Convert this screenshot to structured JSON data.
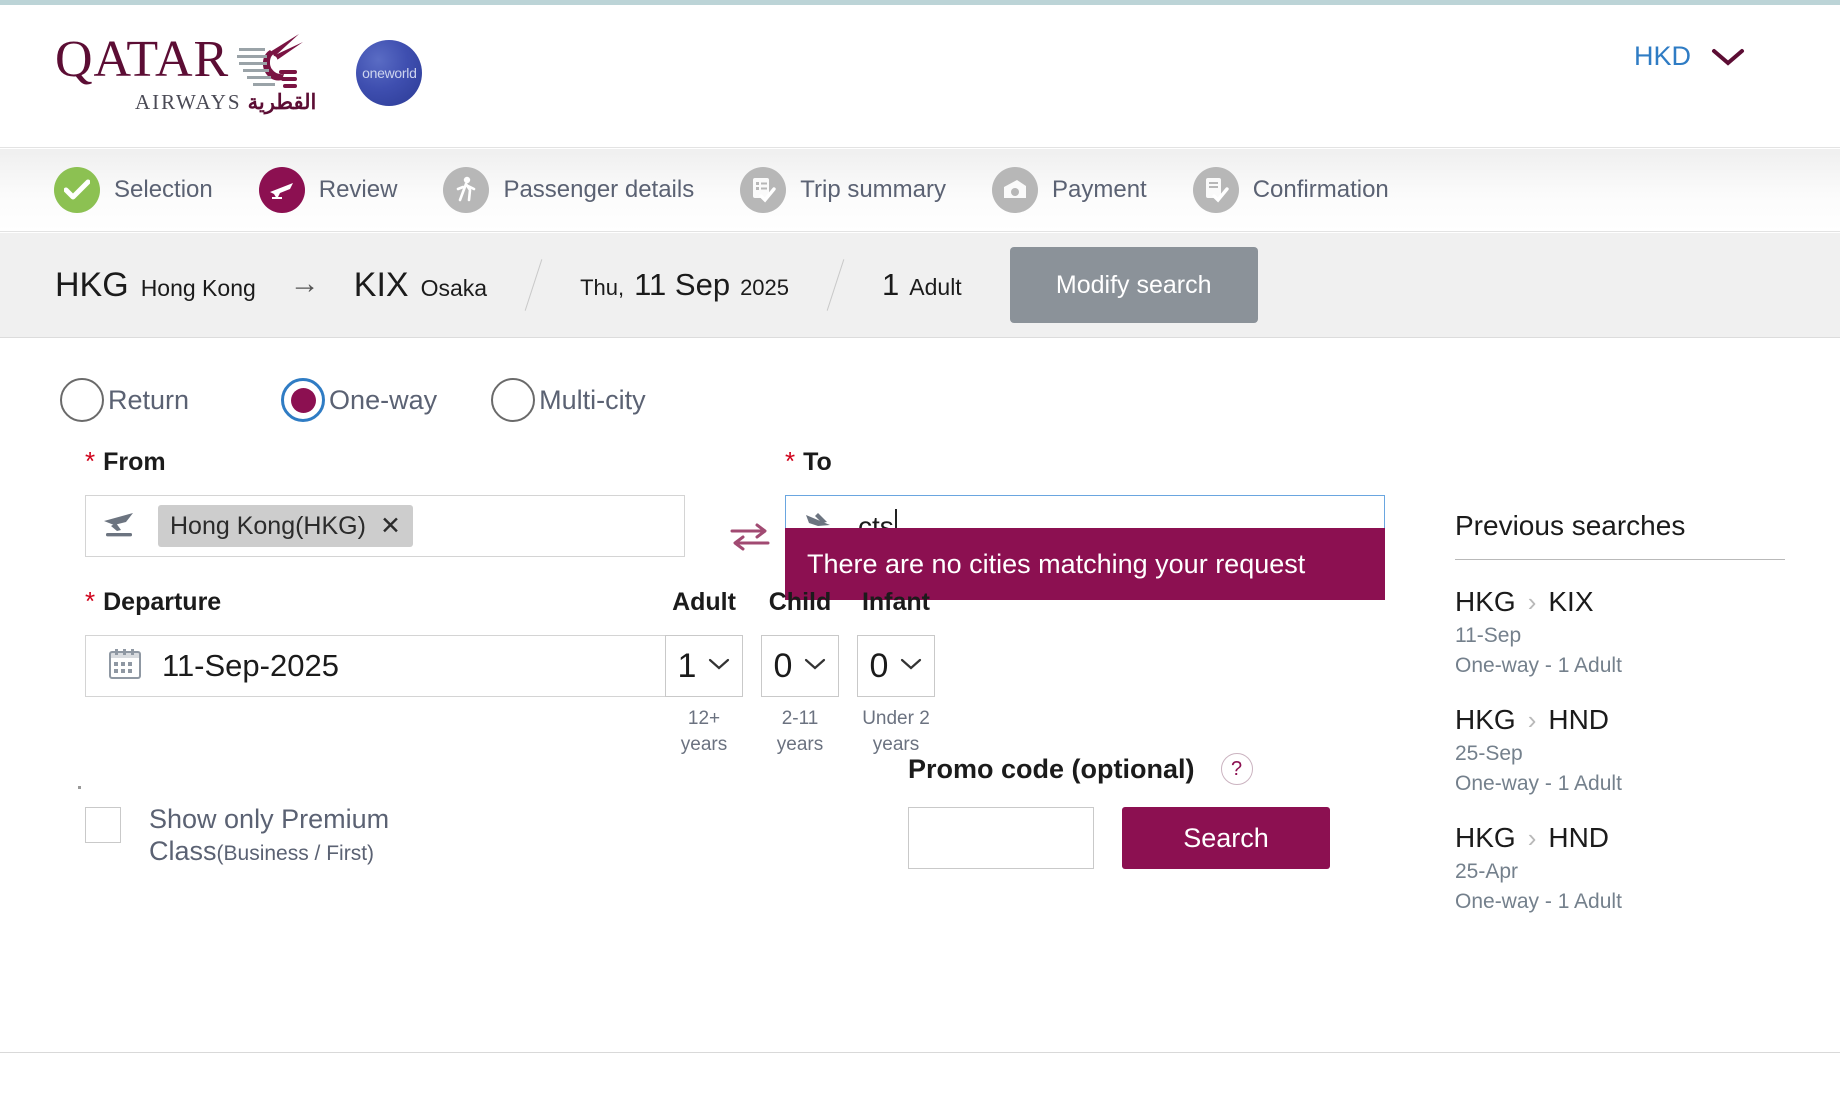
{
  "header": {
    "brand_name": "QATAR",
    "brand_sub_en": "AIRWAYS",
    "brand_sub_ar": "القطرية",
    "alliance": "oneworld",
    "currency": "HKD",
    "currency_caret_icon": "chevron-down-icon"
  },
  "steps": [
    {
      "label": "Selection",
      "icon": "check-icon",
      "state": "done"
    },
    {
      "label": "Review",
      "icon": "plane-icon",
      "state": "active"
    },
    {
      "label": "Passenger details",
      "icon": "walking-person-icon",
      "state": "upcoming"
    },
    {
      "label": "Trip summary",
      "icon": "checklist-icon",
      "state": "upcoming"
    },
    {
      "label": "Payment",
      "icon": "wallet-icon",
      "state": "upcoming"
    },
    {
      "label": "Confirmation",
      "icon": "document-check-icon",
      "state": "upcoming"
    }
  ],
  "summary": {
    "origin_code": "HKG",
    "origin_city": "Hong Kong",
    "arrow_icon": "arrow-right-icon",
    "dest_code": "KIX",
    "dest_city": "Osaka",
    "day_of_week": "Thu,",
    "date_day_month": "11 Sep",
    "date_year": "2025",
    "pax_count": "1",
    "pax_label": "Adult",
    "modify_label": "Modify search"
  },
  "trip_types": [
    {
      "label": "Return",
      "selected": false
    },
    {
      "label": "One-way",
      "selected": true
    },
    {
      "label": "Multi-city",
      "selected": false
    }
  ],
  "form": {
    "from_label": "From",
    "from_required_mark": "*",
    "from_icon": "departure-plane-icon",
    "from_chip": "Hong Kong(HKG)",
    "from_chip_remove_icon": "close-icon",
    "to_label": "To",
    "to_required_mark": "*",
    "to_icon": "arrival-plane-icon",
    "to_value": "cts",
    "swap_icon": "swap-arrows-icon",
    "no_match_message": "There are no cities matching your request",
    "departure_label": "Departure",
    "departure_required_mark": "*",
    "departure_icon": "calendar-icon",
    "departure_value": "11-Sep-2025",
    "passengers": [
      {
        "title": "Adult",
        "value": "1",
        "age": "12+ years"
      },
      {
        "title": "Child",
        "value": "0",
        "age": "2-11 years"
      },
      {
        "title": "Infant",
        "value": "0",
        "age": "Under 2 years"
      }
    ],
    "premium_label": "Show only Premium Class",
    "premium_label_small": "(Business / First)",
    "promo_label": "Promo code (optional)",
    "promo_help_icon": "question-mark-icon",
    "promo_value": "",
    "promo_placeholder": "",
    "search_label": "Search"
  },
  "previous_searches": {
    "title": "Previous searches",
    "items": [
      {
        "origin": "HKG",
        "sep_icon": "chevron-right-icon",
        "dest": "KIX",
        "date": "11-Sep",
        "detail": "One-way - 1 Adult"
      },
      {
        "origin": "HKG",
        "sep_icon": "chevron-right-icon",
        "dest": "HND",
        "date": "25-Sep",
        "detail": "One-way - 1 Adult"
      },
      {
        "origin": "HKG",
        "sep_icon": "chevron-right-icon",
        "dest": "HND",
        "date": "25-Apr",
        "detail": "One-way - 1 Adult"
      }
    ]
  },
  "colors": {
    "brand_maroon": "#8c1051",
    "accent_blue": "#2f7cc4",
    "step_done_green": "#8cc152",
    "step_grey": "#b7b7b7",
    "modify_grey": "#8b9299"
  }
}
